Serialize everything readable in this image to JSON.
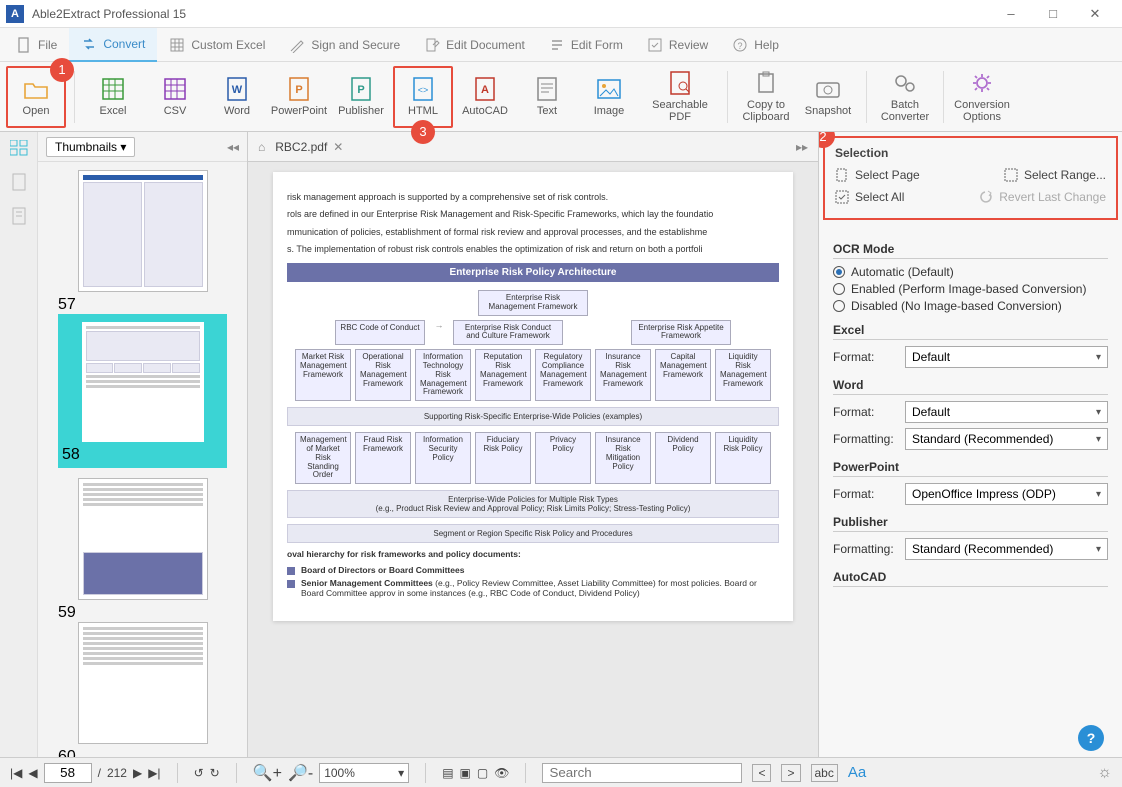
{
  "app": {
    "title": "Able2Extract Professional 15"
  },
  "menu": {
    "file": "File",
    "convert": "Convert",
    "custom_excel": "Custom Excel",
    "sign_secure": "Sign and Secure",
    "edit_document": "Edit Document",
    "edit_form": "Edit Form",
    "review": "Review",
    "help": "Help"
  },
  "ribbon": {
    "open": "Open",
    "excel": "Excel",
    "csv": "CSV",
    "word": "Word",
    "powerpoint": "PowerPoint",
    "publisher": "Publisher",
    "html": "HTML",
    "autocad": "AutoCAD",
    "text": "Text",
    "image": "Image",
    "searchable_pdf": "Searchable PDF",
    "copy_clipboard": "Copy to Clipboard",
    "snapshot": "Snapshot",
    "batch": "Batch Converter",
    "options": "Conversion Options"
  },
  "badges": {
    "one": "1",
    "two": "2",
    "three": "3"
  },
  "thumbs": {
    "header": "Thumbnails",
    "p57": "57",
    "p58": "58",
    "p59": "59",
    "p60": "60"
  },
  "doc": {
    "tab_name": "RBC2.pdf",
    "para1": "risk management approach is supported by a comprehensive set of risk controls.",
    "para2": "rols are defined in our Enterprise Risk Management and Risk-Specific Frameworks, which lay the foundatio",
    "para3": "mmunication of policies, establishment of formal risk review and approval processes, and the establishme",
    "para4": "s. The implementation of robust risk controls enables the optimization of risk and return on both a portfoli",
    "chart_title": "Enterprise Risk Policy Architecture",
    "n_top": "Enterprise Risk Management Framework",
    "n_code": "RBC Code of Conduct",
    "n_conduct": "Enterprise Risk Conduct and Culture Framework",
    "n_appetite": "Enterprise Risk Appetite Framework",
    "r2": [
      "Market Risk Management Framework",
      "Operational Risk Management Framework",
      "Information Technology Risk Management Framework",
      "Reputation Risk Management Framework",
      "Regulatory Compliance Management Framework",
      "Insurance Risk Management Framework",
      "Capital Management Framework",
      "Liquidity Risk Management Framework"
    ],
    "band1": "Supporting Risk-Specific Enterprise-Wide Policies (examples)",
    "r3": [
      "Management of Market Risk Standing Order",
      "Fraud Risk Framework",
      "Information Security Policy",
      "Fiduciary Risk Policy",
      "Privacy Policy",
      "Insurance Risk Mitigation Policy",
      "Dividend Policy",
      "Liquidity Risk Policy"
    ],
    "band2a": "Enterprise-Wide Policies for Multiple Risk Types",
    "band2b": "(e.g., Product Risk Review and Approval Policy; Risk Limits Policy; Stress-Testing Policy)",
    "band3": "Segment or Region Specific Risk Policy and Procedures",
    "bh": "oval hierarchy for risk frameworks and policy documents:",
    "b1": "Board of Directors or Board Committees",
    "b2a": "Senior Management Committees",
    "b2b": " (e.g., Policy Review Committee, Asset Liability Committee) for most policies. Board or Board Committee approv in some instances (e.g., RBC Code of Conduct, Dividend Policy)"
  },
  "right": {
    "selection_h": "Selection",
    "select_page": "Select Page",
    "select_range": "Select Range...",
    "select_all": "Select All",
    "revert": "Revert Last Change",
    "ocr_h": "OCR Mode",
    "ocr_auto": "Automatic (Default)",
    "ocr_enabled": "Enabled (Perform Image-based Conversion)",
    "ocr_disabled": "Disabled (No Image-based Conversion)",
    "excel_h": "Excel",
    "word_h": "Word",
    "pp_h": "PowerPoint",
    "pub_h": "Publisher",
    "acad_h": "AutoCAD",
    "format_l": "Format:",
    "formatting_l": "Formatting:",
    "default": "Default",
    "std_rec": "Standard (Recommended)",
    "odp": "OpenOffice Impress (ODP)"
  },
  "status": {
    "page": "58",
    "total": "212",
    "slash": "/",
    "zoom": "100%",
    "search_ph": "Search",
    "abc": "abc",
    "Aa": "Aa"
  }
}
